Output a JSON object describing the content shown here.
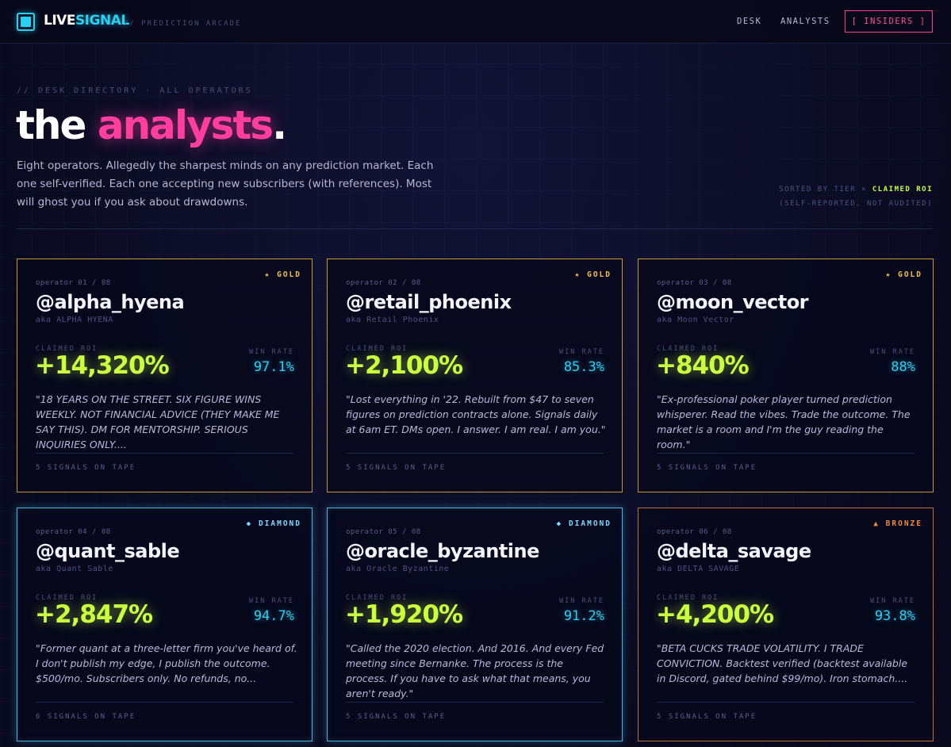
{
  "brand": {
    "live": "LIVE",
    "signal": "SIGNAL",
    "tagline": "// PREDICTION ARCADE"
  },
  "nav": {
    "desk": "DESK",
    "analysts": "ANALYSTS",
    "insiders": "[ INSIDERS ]"
  },
  "hero": {
    "eyebrow": "// DESK DIRECTORY · ALL OPERATORS",
    "title_plain": "the ",
    "title_accent": "analysts",
    "title_dot": ".",
    "description": "Eight operators. Allegedly the sharpest minds on any prediction market. Each one self-verified. Each one accepting new subscribers (with references). Most will ghost you if you ask about drawdowns.",
    "sort_prefix": "SORTED BY TIER × ",
    "sort_highlight": "CLAIMED ROI",
    "sort_note": "(SELF-REPORTED, NOT AUDITED)"
  },
  "labels": {
    "claimed_roi": "CLAIMED ROI",
    "win_rate": "WIN RATE"
  },
  "colors": {
    "accent_pink": "#ff3ea0",
    "accent_cyan": "#2ad0f0",
    "accent_lime": "#c9ff3e",
    "gold": "#f2c14a",
    "diamond": "#7ad8ff",
    "bronze": "#e88a3e"
  },
  "cards": [
    {
      "tier": "★ GOLD",
      "index": "operator 01 / 08",
      "handle": "@alpha_hyena",
      "aka": "aka ALPHA HYENA",
      "roi": "+14,320%",
      "win_rate": "97.1%",
      "quote": "\"18 YEARS ON THE STREET. SIX FIGURE WINS WEEKLY. NOT FINANCIAL ADVICE (THEY MAKE ME SAY THIS). DM FOR MENTORSHIP. SERIOUS INQUIRIES ONLY....",
      "tape": "5 SIGNALS ON TAPE"
    },
    {
      "tier": "★ GOLD",
      "index": "operator 02 / 08",
      "handle": "@retail_phoenix",
      "aka": "aka Retail Phoenix",
      "roi": "+2,100%",
      "win_rate": "85.3%",
      "quote": "\"Lost everything in '22. Rebuilt from $47 to seven figures on prediction contracts alone. Signals daily at 6am ET. DMs open. I answer. I am real. I am you.\"",
      "tape": "5 SIGNALS ON TAPE"
    },
    {
      "tier": "★ GOLD",
      "index": "operator 03 / 08",
      "handle": "@moon_vector",
      "aka": "aka Moon Vector",
      "roi": "+840%",
      "win_rate": "88%",
      "quote": "\"Ex-professional poker player turned prediction whisperer. Read the vibes. Trade the outcome. The market is a room and I'm the guy reading the room.\"",
      "tape": "5 SIGNALS ON TAPE"
    },
    {
      "tier": "◆ DIAMOND",
      "index": "operator 04 / 08",
      "handle": "@quant_sable",
      "aka": "aka Quant Sable",
      "roi": "+2,847%",
      "win_rate": "94.7%",
      "quote": "\"Former quant at a three-letter firm you've heard of. I don't publish my edge, I publish the outcome. $500/mo. Subscribers only. No refunds, no...",
      "tape": "6 SIGNALS ON TAPE"
    },
    {
      "tier": "◆ DIAMOND",
      "index": "operator 05 / 08",
      "handle": "@oracle_byzantine",
      "aka": "aka Oracle Byzantine",
      "roi": "+1,920%",
      "win_rate": "91.2%",
      "quote": "\"Called the 2020 election. And 2016. And every Fed meeting since Bernanke. The process is the process. If you have to ask what that means, you aren't ready.\"",
      "tape": "5 SIGNALS ON TAPE"
    },
    {
      "tier": "▲ BRONZE",
      "index": "operator 06 / 08",
      "handle": "@delta_savage",
      "aka": "aka DELTA SAVAGE",
      "roi": "+4,200%",
      "win_rate": "93.8%",
      "quote": "\"BETA CUCKS TRADE VOLATILITY. I TRADE CONVICTION. Backtest verified (backtest available in Discord, gated behind $99/mo). Iron stomach....",
      "tape": "5 SIGNALS ON TAPE"
    }
  ]
}
